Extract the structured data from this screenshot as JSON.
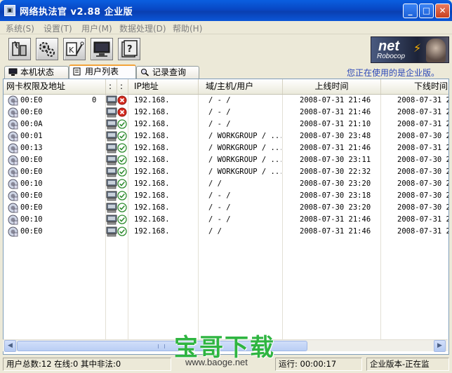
{
  "window": {
    "title": "网络执法官 v2.88 企业版",
    "buttons": {
      "minimize": "_",
      "maximize": "□",
      "close": "✕"
    }
  },
  "menu": [
    "系统(S)",
    "设置(T)",
    "用户(M)",
    "数据处理(D)",
    "帮助(H)"
  ],
  "toolbar_icons": [
    "nic-config-icon",
    "settings-gears-icon",
    "keys-permission-icon",
    "monitor-icon",
    "help-book-icon"
  ],
  "logo": {
    "line1": "net",
    "line2": "Robocop"
  },
  "tabs": [
    {
      "label": "本机状态",
      "icon": "computer-status-icon"
    },
    {
      "label": "用户列表",
      "icon": "user-list-icon"
    },
    {
      "label": "记录查询",
      "icon": "search-records-icon"
    }
  ],
  "active_tab": 1,
  "edition_note": "您正在使用的是企业版。",
  "columns": [
    "网卡权限及地址",
    ":",
    ":",
    "IP地址",
    "域/主机/用户",
    "上线时间",
    "下线时间"
  ],
  "rows": [
    {
      "mac": "00:E0",
      "mac_tail": "0",
      "status": "offline",
      "ip": "192.168.",
      "host": "/ - /",
      "on": "2008-07-31 21:46",
      "off": "2008-07-31 2"
    },
    {
      "mac": "00:E0",
      "mac_tail": "",
      "status": "offline",
      "ip": "192.168.",
      "host": "/ - /",
      "on": "2008-07-31 21:46",
      "off": "2008-07-31 2"
    },
    {
      "mac": "00:0A",
      "mac_tail": "",
      "status": "online",
      "ip": "192.168.",
      "host": "/ - /",
      "on": "2008-07-31 21:10",
      "off": "2008-07-31 2"
    },
    {
      "mac": "00:01",
      "mac_tail": "",
      "status": "online",
      "ip": "192.168.",
      "host": "/ WORKGROUP / ...",
      "on": "2008-07-30 23:48",
      "off": "2008-07-30 2"
    },
    {
      "mac": "00:13",
      "mac_tail": "",
      "status": "online",
      "ip": "192.168.",
      "host": "/ WORKGROUP / ...",
      "on": "2008-07-31 21:46",
      "off": "2008-07-31 2"
    },
    {
      "mac": "00:E0",
      "mac_tail": "",
      "status": "online",
      "ip": "192.168.",
      "host": "/ WORKGROUP / ...",
      "on": "2008-07-30 23:11",
      "off": "2008-07-30 2"
    },
    {
      "mac": "00:E0",
      "mac_tail": "",
      "status": "online",
      "ip": "192.168.",
      "host": "/ WORKGROUP / ...",
      "on": "2008-07-30 22:32",
      "off": "2008-07-30 2"
    },
    {
      "mac": "00:10",
      "mac_tail": "",
      "status": "online",
      "ip": "192.168.",
      "host": "/  /",
      "on": "2008-07-30 23:20",
      "off": "2008-07-30 2"
    },
    {
      "mac": "00:E0",
      "mac_tail": "",
      "status": "online",
      "ip": "192.168.",
      "host": "/ - /",
      "on": "2008-07-30 23:18",
      "off": "2008-07-30 2"
    },
    {
      "mac": "00:E0",
      "mac_tail": "",
      "status": "online",
      "ip": "192.168.",
      "host": "/ - /",
      "on": "2008-07-30 23:20",
      "off": "2008-07-30 2"
    },
    {
      "mac": "00:10",
      "mac_tail": "",
      "status": "online",
      "ip": "192.168.",
      "host": "/ - /",
      "on": "2008-07-31 21:46",
      "off": "2008-07-31 2"
    },
    {
      "mac": "00:E0",
      "mac_tail": "",
      "status": "online",
      "ip": "192.168.",
      "host": "/  /",
      "on": "2008-07-31 21:46",
      "off": "2008-07-31 2"
    }
  ],
  "status": {
    "users": "用户总数:12 在线:0 其中非法:0",
    "running": "运行: 00:00:17",
    "mode": "企业版本-正在监"
  },
  "watermark": {
    "text": "宝哥下载",
    "url": "www.baoge.net"
  },
  "colors": {
    "title_bar": "#0a4fd0",
    "edition_text": "#2b47b8",
    "tab_accent": "#f3a33b",
    "watermark": "#2fb541"
  }
}
